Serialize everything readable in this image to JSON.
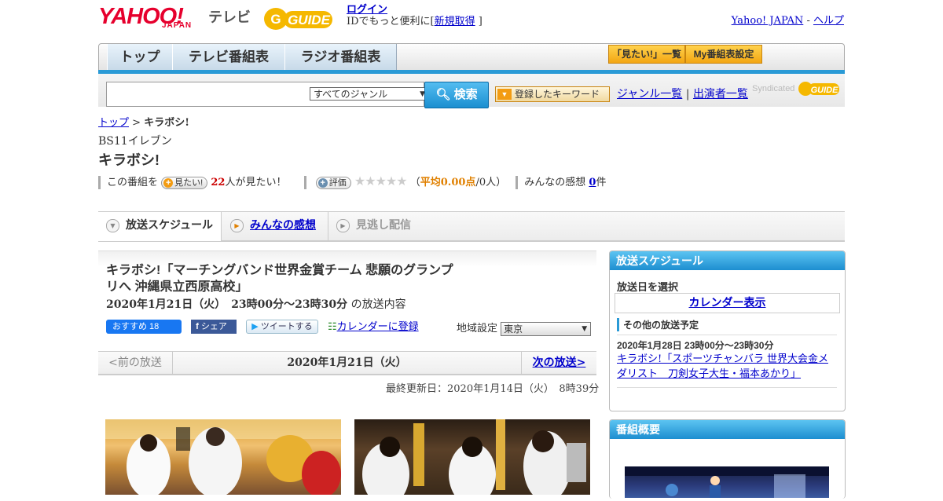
{
  "header": {
    "logo_text": "YAHOO!",
    "logo_sub": "JAPAN",
    "tv_label": "テレビ",
    "gguide_label": "GUIDE",
    "login": "ログイン",
    "login_sub_prefix": "IDでもっと便利に[",
    "signup": "新規取得",
    "login_sub_suffix": "]",
    "yahoo_japan": "Yahoo! JAPAN",
    "sep": "-",
    "help": "ヘルプ"
  },
  "nav": {
    "tabs": [
      "トップ",
      "テレビ番組表",
      "ラジオ番組表"
    ],
    "mitai_list": "「見たい!」一覧",
    "my_schedule": "My番組表設定"
  },
  "search": {
    "genre": "すべてのジャンル",
    "button": "検索",
    "keyword_btn": "登録したキーワード",
    "genre_list": "ジャンル一覧",
    "divider": "|",
    "performers": "出演者一覧",
    "syndicated": "Syndicated"
  },
  "breadcrumb": {
    "top": "トップ",
    "sep": ">",
    "current": "キラボシ!"
  },
  "program": {
    "channel": "BS11イレブン",
    "title": "キラボシ!",
    "stats": {
      "prefix": "この番組を",
      "mitai_btn": "見たい!",
      "count": "22",
      "count_suffix": "人が見たい！",
      "rate_btn": "評価",
      "stars": "★★★★★",
      "avg_open": "（",
      "avg_label": "平均0.00点",
      "avg_people": "/0人）",
      "impressions_label": "みんなの感想",
      "impressions_count": "0",
      "impressions_suffix": "件"
    }
  },
  "page_tabs": [
    "放送スケジュール",
    "みんなの感想",
    "見逃し配信"
  ],
  "episode": {
    "title": "キラボシ!「マーチングバンド世界金賞チーム 悲願のグランプリへ 沖縄県立西原高校」",
    "time": "2020年1月21日（火）　23時00分～23時30分",
    "time_suffix": "の放送内容",
    "fb_recommend": "おすすめ 18",
    "fb_share": "シェア",
    "tweet": "ツイートする",
    "calendar": "カレンダーに登録",
    "region_label": "地域設定",
    "region_value": "東京"
  },
  "episode_nav": {
    "prev": "<前の放送",
    "date": "2020年1月21日（火）",
    "next": "次の放送>"
  },
  "updated": "最終更新日：2020年1月14日（火）　8時39分",
  "sidebar": {
    "schedule_head": "放送スケジュール",
    "select_date": "放送日を選択",
    "calendar_btn": "カレンダー表示",
    "other_head": "その他の放送予定",
    "other_time": "2020年1月28日 23時00分～23時30分",
    "other_title": "キラボシ!「スポーツチャンバラ 世界大会金メダリスト　刀剣女子大生・福本あかり」",
    "overview_head": "番組概要"
  },
  "colors": {
    "accent_blue": "#2a9ad6",
    "brand_red": "#e6002d",
    "orange": "#f39c12"
  }
}
